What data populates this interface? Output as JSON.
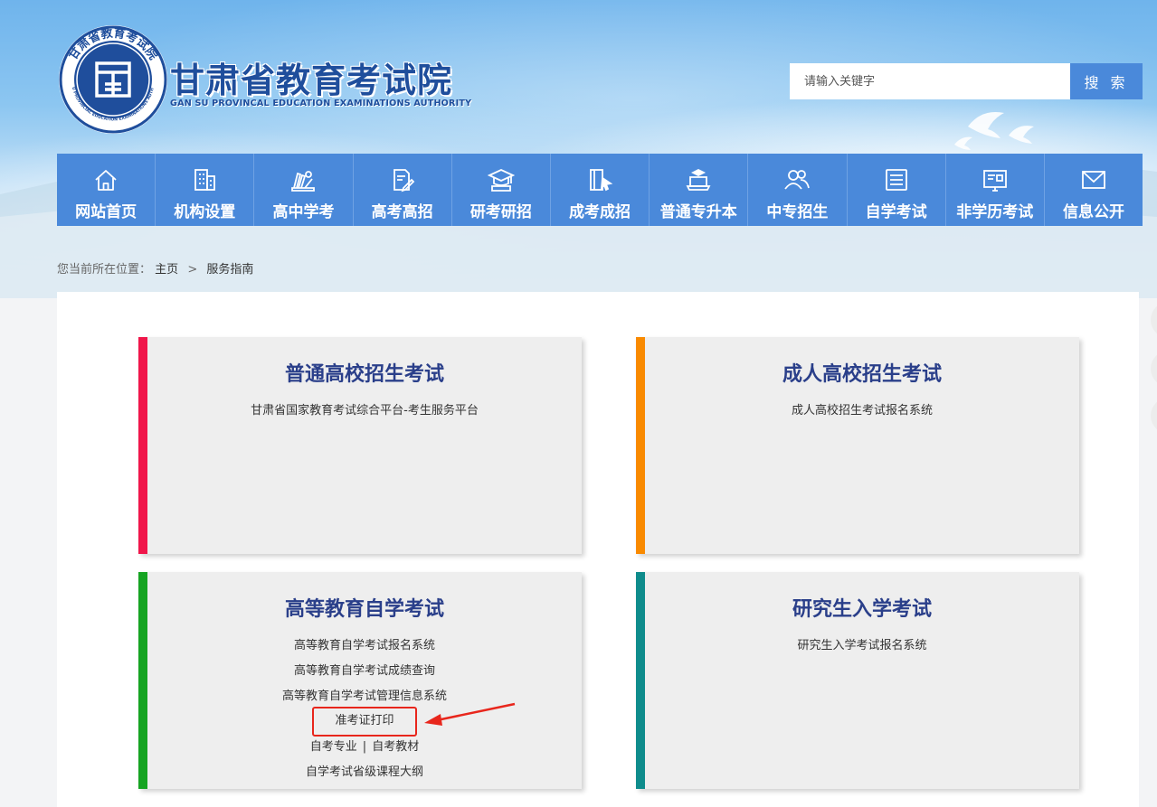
{
  "header": {
    "site_title": "甘肃省教育考试院",
    "site_subtitle": "GAN SU PROVINCAL EDUCATION EXAMINATIONS AUTHORITY",
    "logo_ring_cn": "甘肃省教育考试院",
    "logo_ring_en": "GANSU PROVINCIAL EDUCATION EXAMINATIONS AUTHORITY",
    "logo_center_glyph": "囯",
    "colors": {
      "brand": "#1f4e9c",
      "nav": "#4a89da"
    }
  },
  "search": {
    "placeholder": "请输入关键字",
    "value": "",
    "button_label": "搜 索"
  },
  "nav": {
    "items": [
      {
        "label": "网站首页",
        "icon": "home-icon"
      },
      {
        "label": "机构设置",
        "icon": "building-icon"
      },
      {
        "label": "高中学考",
        "icon": "books-icon"
      },
      {
        "label": "高考高招",
        "icon": "document-pen-icon"
      },
      {
        "label": "研考研招",
        "icon": "graduation-cap-icon"
      },
      {
        "label": "成考成招",
        "icon": "book-cursor-icon"
      },
      {
        "label": "普通专升本",
        "icon": "laptop-cap-icon"
      },
      {
        "label": "中专招生",
        "icon": "users-icon"
      },
      {
        "label": "自学考试",
        "icon": "notes-icon"
      },
      {
        "label": "非学历考试",
        "icon": "certificate-icon"
      },
      {
        "label": "信息公开",
        "icon": "mail-icon"
      }
    ]
  },
  "breadcrumb": {
    "prefix": "您当前所在位置：",
    "home": "主页",
    "separator": ">",
    "current": "服务指南"
  },
  "cards": [
    {
      "title": "普通高校招生考试",
      "accent": "#f0164a",
      "links": [
        "甘肃省国家教育考试综合平台-考生服务平台"
      ]
    },
    {
      "title": "成人高校招生考试",
      "accent": "#f98a00",
      "links": [
        "成人高校招生考试报名系统"
      ]
    },
    {
      "title": "高等教育自学考试",
      "accent": "#16a422",
      "links": [
        "高等教育自学考试报名系统",
        "高等教育自学考试成绩查询",
        "高等教育自学考试管理信息系统",
        "准考证打印",
        "自考专业",
        "自考教材",
        "自学考试省级课程大纲"
      ],
      "pair_separator": "|"
    },
    {
      "title": "研究生入学考试",
      "accent": "#0e8c8c",
      "links": [
        "研究生入学考试报名系统"
      ]
    }
  ],
  "annotation": {
    "highlight_color": "#e8261c"
  }
}
